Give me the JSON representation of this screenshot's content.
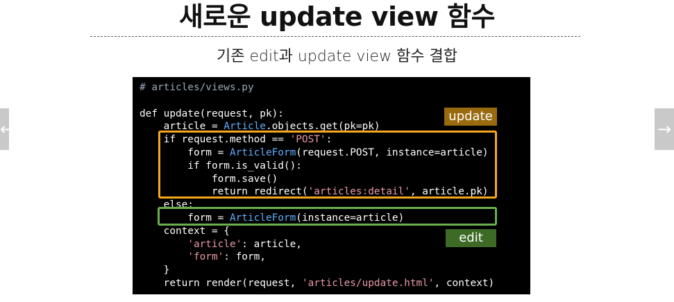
{
  "slide": {
    "title": "새로운 update view 함수",
    "subtitle": "기존 edit과 update view 함수 결합"
  },
  "navigation": {
    "prev_symbol": "←",
    "next_symbol": "→"
  },
  "code": {
    "comment": "# articles/views.py",
    "lines": [
      "def update(request, pk):",
      "    article = Article.objects.get(pk=pk)",
      "    if request.method == 'POST':",
      "        form = ArticleForm(request.POST, instance=article)",
      "        if form.is_valid():",
      "            form.save()",
      "            return redirect('articles:detail', article.pk)",
      "    else:",
      "        form = ArticleForm(instance=article)",
      "    context = {",
      "        'article': article,",
      "        'form': form,",
      "    }",
      "    return render(request, 'articles/update.html', context)"
    ]
  },
  "labels": {
    "update_tag": "update",
    "edit_tag": "edit"
  },
  "colors": {
    "update_box": "#f6a81f",
    "edit_box": "#6ab04c",
    "update_tag_bg": "#9a6a10",
    "edit_tag_bg": "#3d6b26",
    "string": "#e89aa6",
    "class_name": "#5fb0ff",
    "comment": "#9aa7b8",
    "code_background": "#000000"
  }
}
